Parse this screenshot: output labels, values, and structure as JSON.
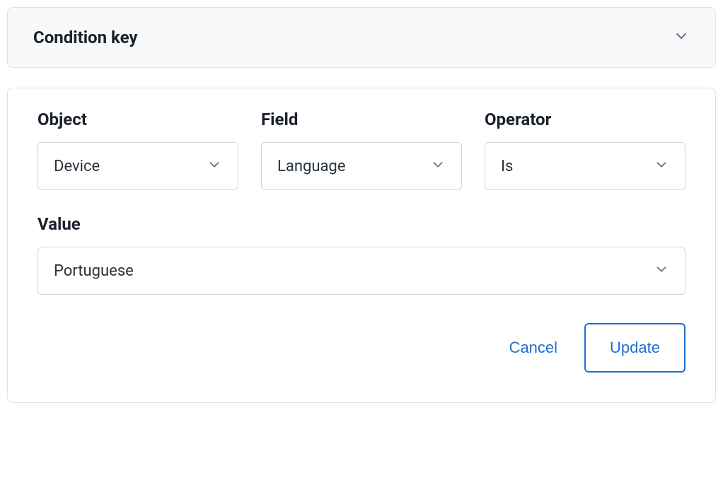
{
  "accordion": {
    "title": "Condition key"
  },
  "form": {
    "object": {
      "label": "Object",
      "value": "Device"
    },
    "field": {
      "label": "Field",
      "value": "Language"
    },
    "operator": {
      "label": "Operator",
      "value": "Is"
    },
    "value_field": {
      "label": "Value",
      "value": "Portuguese"
    }
  },
  "buttons": {
    "cancel": "Cancel",
    "update": "Update"
  }
}
